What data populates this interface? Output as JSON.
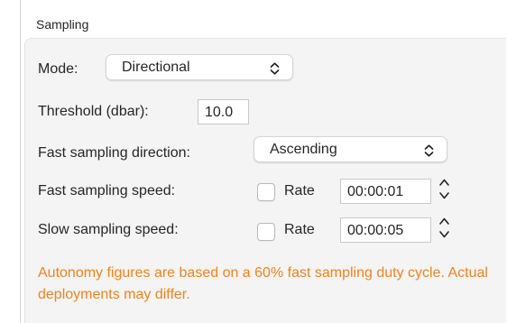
{
  "window": {
    "section_title": "Sampling"
  },
  "mode": {
    "label": "Mode:",
    "value": "Directional"
  },
  "threshold": {
    "label": "Threshold (dbar):",
    "value": "10.0"
  },
  "fast_direction": {
    "label": "Fast sampling direction:",
    "value": "Ascending"
  },
  "fast_speed": {
    "label": "Fast sampling speed:",
    "rate_label": "Rate",
    "rate_checked": false,
    "time": "00:00:01"
  },
  "slow_speed": {
    "label": "Slow sampling speed:",
    "rate_label": "Rate",
    "rate_checked": false,
    "time": "00:00:05"
  },
  "note": {
    "text": "Autonomy figures are based on a 60% fast sampling duty cycle. Actual deployments may differ.",
    "color": "#f0831e"
  },
  "icons": {
    "popup_indicator": "updown-chevron-icon",
    "stepper": "stepper-arrows-icon"
  }
}
